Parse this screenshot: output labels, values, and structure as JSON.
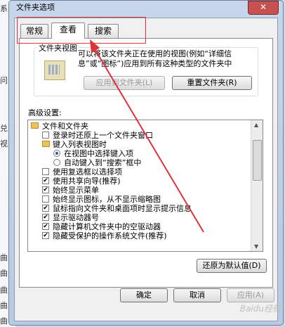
{
  "background": {
    "left_chars": [
      "系",
      "问",
      "兑",
      "视",
      "曲",
      "曲",
      "曲",
      "曲",
      "曲"
    ]
  },
  "window": {
    "title": "文件夹选项",
    "close_label": "✕"
  },
  "tabs": [
    {
      "label": "常规",
      "active": false
    },
    {
      "label": "查看",
      "active": true
    },
    {
      "label": "搜索",
      "active": false
    }
  ],
  "folder_views": {
    "group_label": "文件夹视图",
    "description": "可以将该文件夹正在使用的视图(例如“详细信息”或“图标”)应用到所有这种类型的文件夹中",
    "apply_button": "应用到文件夹(L)",
    "reset_button": "重置文件夹(R)"
  },
  "advanced": {
    "label": "高级设置:",
    "items": [
      {
        "kind": "folder",
        "text": "文件和文件夹",
        "indent": 0
      },
      {
        "kind": "checkbox",
        "checked": false,
        "text": "登录时还原上一个文件夹窗口",
        "indent": 1
      },
      {
        "kind": "folder",
        "text": "键入列表视图时",
        "indent": 1
      },
      {
        "kind": "radio",
        "checked": true,
        "text": "在视图中选择键入项",
        "indent": 2
      },
      {
        "kind": "radio",
        "checked": false,
        "text": "自动键入到“搜索”框中",
        "indent": 2
      },
      {
        "kind": "checkbox",
        "checked": false,
        "text": "使用复选框以选择项",
        "indent": 1
      },
      {
        "kind": "checkbox",
        "checked": true,
        "text": "使用共享向导(推荐)",
        "indent": 1
      },
      {
        "kind": "checkbox",
        "checked": true,
        "text": "始终显示菜单",
        "indent": 1
      },
      {
        "kind": "checkbox",
        "checked": false,
        "text": "始终显示图标，从不显示缩略图",
        "indent": 1
      },
      {
        "kind": "checkbox",
        "checked": true,
        "text": "鼠标指向文件夹和桌面项时显示提示信息",
        "indent": 1
      },
      {
        "kind": "checkbox",
        "checked": true,
        "text": "显示驱动器号",
        "indent": 1
      },
      {
        "kind": "checkbox",
        "checked": true,
        "text": "隐藏计算机文件夹中的空驱动器",
        "indent": 1
      },
      {
        "kind": "checkbox",
        "checked": true,
        "text": "隐藏受保护的操作系统文件(推荐)",
        "indent": 1
      }
    ],
    "restore_button": "还原为默认值(D)"
  },
  "footer": {
    "ok": "确定",
    "cancel": "取消",
    "apply": "应用(A)"
  },
  "watermark": "Baidu经验"
}
